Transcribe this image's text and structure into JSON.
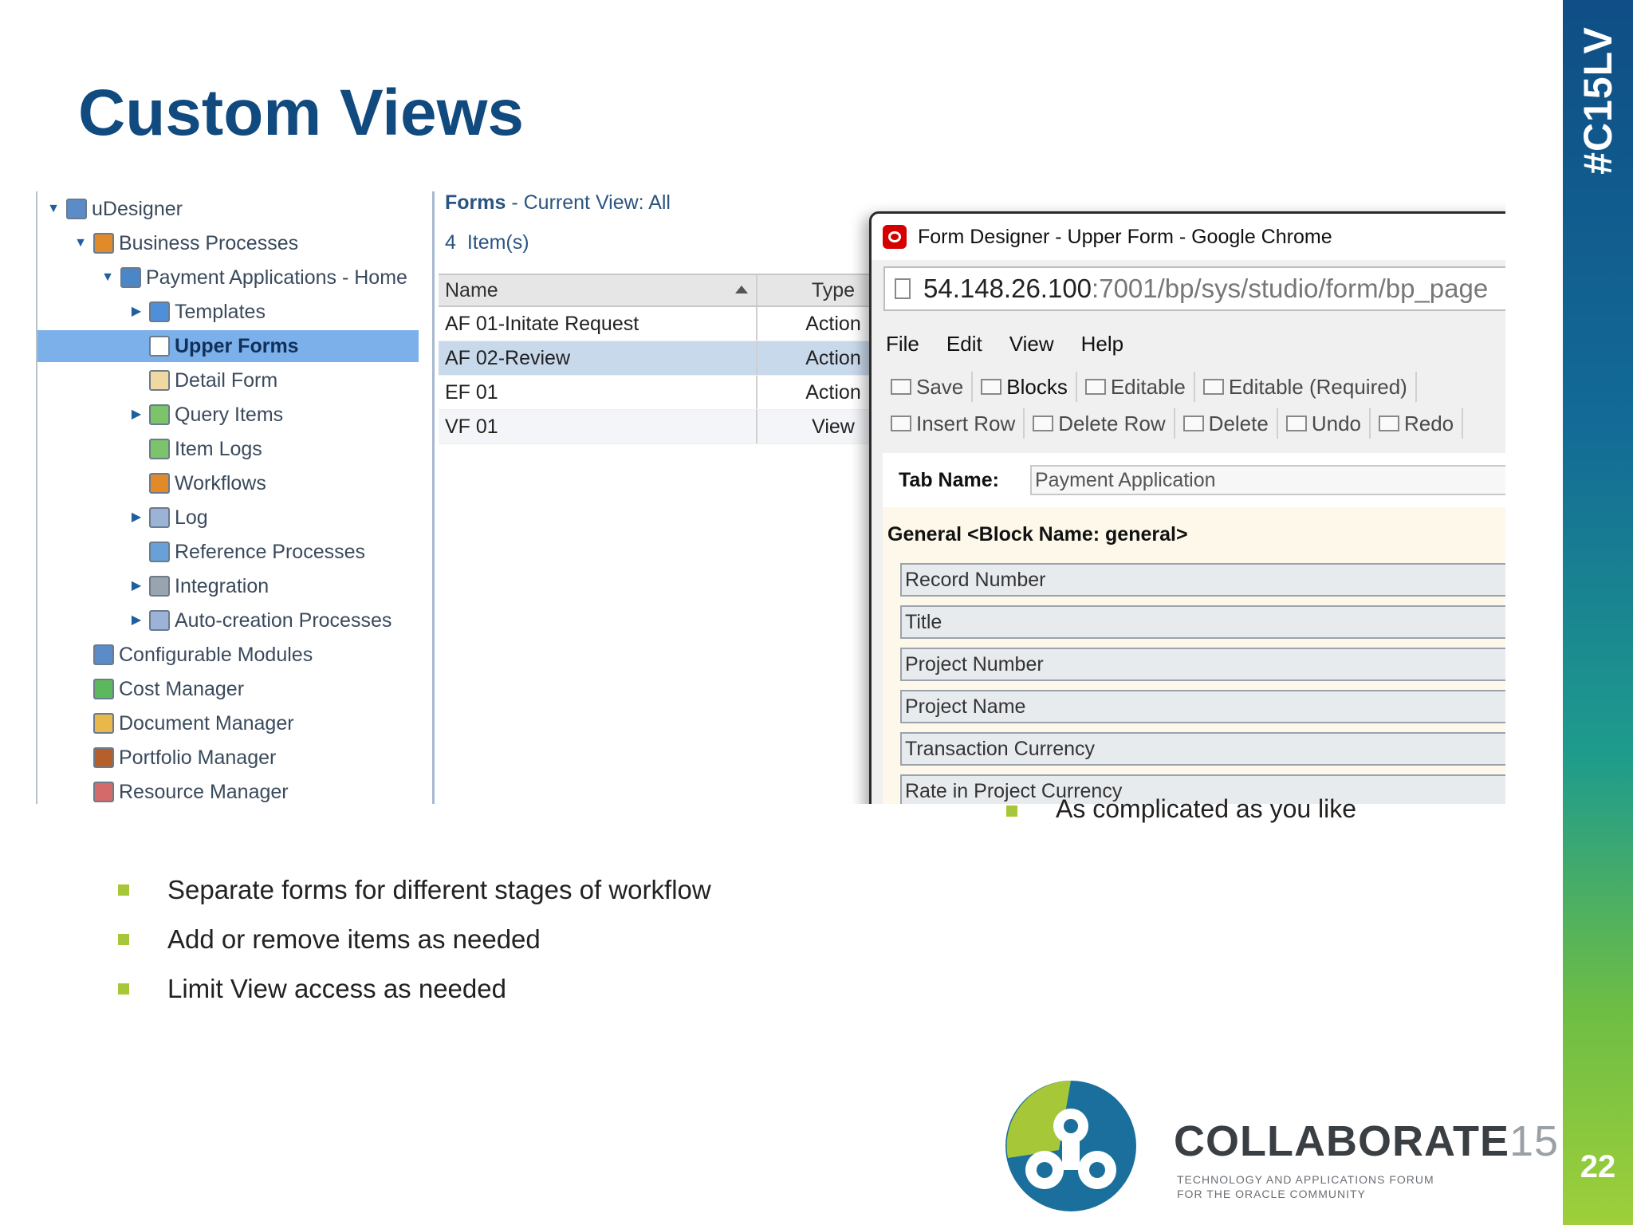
{
  "slide": {
    "title": "Custom Views",
    "hashtag": "#C15LV",
    "page_number": "22",
    "bullets": [
      "Separate forms for different stages of workflow",
      "Add or remove items as needed",
      "Limit View access as needed"
    ],
    "hidden_bullet": "As complicated as you like",
    "logo": {
      "wordmark": "COLLABORATE",
      "wordmark_number": "15",
      "tagline_1": "TECHNOLOGY AND APPLICATIONS FORUM",
      "tagline_2": "FOR THE ORACLE COMMUNITY"
    },
    "colors": {
      "title": "#114a7f",
      "bullet": "#a6c738",
      "selection": "#7cb0ea"
    }
  },
  "tree": {
    "items": [
      {
        "label": "uDesigner",
        "icon": "designer-icon",
        "expanded": true
      },
      {
        "label": "Business Processes",
        "icon": "process-icon",
        "expanded": true
      },
      {
        "label": "Payment Applications - Home",
        "icon": "app-icon",
        "expanded": true
      },
      {
        "label": "Templates",
        "icon": "template-icon",
        "collapsed": true
      },
      {
        "label": "Upper Forms",
        "icon": "form-icon",
        "selected": true
      },
      {
        "label": "Detail Form",
        "icon": "detail-form-icon"
      },
      {
        "label": "Query Items",
        "icon": "query-icon",
        "collapsed": true
      },
      {
        "label": "Item Logs",
        "icon": "log-items-icon"
      },
      {
        "label": "Workflows",
        "icon": "workflow-icon"
      },
      {
        "label": "Log",
        "icon": "log-icon",
        "collapsed": true
      },
      {
        "label": "Reference Processes",
        "icon": "reference-icon"
      },
      {
        "label": "Integration",
        "icon": "integration-icon",
        "collapsed": true
      },
      {
        "label": "Auto-creation Processes",
        "icon": "auto-creation-icon",
        "collapsed": true
      },
      {
        "label": "Configurable Modules",
        "icon": "modules-icon"
      },
      {
        "label": "Cost Manager",
        "icon": "cost-icon"
      },
      {
        "label": "Document Manager",
        "icon": "document-icon"
      },
      {
        "label": "Portfolio Manager",
        "icon": "portfolio-icon"
      },
      {
        "label": "Resource Manager",
        "icon": "resource-icon"
      }
    ]
  },
  "forms": {
    "title": "Forms",
    "view_label": "- Current View:",
    "view_value": "All",
    "count": "4",
    "count_label": "Item(s)",
    "columns": [
      "Name",
      "Type"
    ],
    "rows": [
      {
        "name": "AF 01-Initate Request",
        "type": "Action"
      },
      {
        "name": "AF 02-Review",
        "type": "Action"
      },
      {
        "name": "EF 01",
        "type": "Action"
      },
      {
        "name": "VF 01",
        "type": "View"
      }
    ]
  },
  "popup": {
    "window_title": "Form Designer - Upper Form - Google Chrome",
    "address_host": "54.148.26.100",
    "address_path": ":7001/bp/sys/studio/form/bp_page",
    "menu": [
      "File",
      "Edit",
      "View",
      "Help"
    ],
    "toolbar1": [
      "Save",
      "Blocks",
      "Editable",
      "Editable (Required)"
    ],
    "toolbar2": [
      "Insert Row",
      "Delete Row",
      "Delete",
      "Undo",
      "Redo"
    ],
    "tab_name_label": "Tab Name:",
    "tab_name_value": "Payment Application",
    "block_title": "General <Block Name: general>",
    "fields": [
      "Record Number",
      "Title",
      "Project Number",
      "Project Name",
      "Transaction Currency",
      "Rate in Project Currency"
    ]
  }
}
